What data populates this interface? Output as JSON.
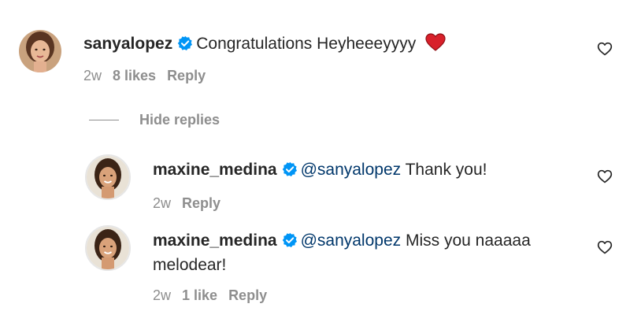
{
  "comment": {
    "username": "sanyalopez",
    "text": "Congratulations Heyheeeyyyy",
    "time": "2w",
    "likes": "8 likes",
    "reply_label": "Reply"
  },
  "hide_replies_label": "Hide replies",
  "replies": [
    {
      "username": "maxine_medina",
      "mention": "@sanyalopez",
      "text": "Thank you!",
      "time": "2w",
      "reply_label": "Reply"
    },
    {
      "username": "maxine_medina",
      "mention": "@sanyalopez",
      "text": "Miss you naaaaa",
      "text_cont": "melodear!",
      "time": "2w",
      "likes": "1 like",
      "reply_label": "Reply"
    }
  ],
  "colors": {
    "text": "#262626",
    "muted": "#8e8e8e",
    "mention": "#00376b",
    "verified": "#0095f6",
    "heart_emoji": "#d8202a"
  },
  "icons": [
    "verified-badge-icon",
    "red-heart-emoji-icon",
    "like-heart-icon"
  ]
}
